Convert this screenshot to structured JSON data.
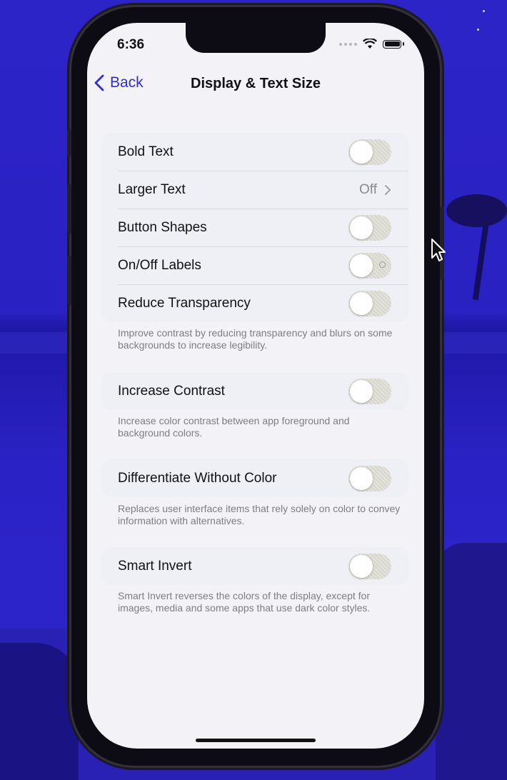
{
  "status_bar": {
    "time": "6:36"
  },
  "nav": {
    "back_label": "Back",
    "title": "Display & Text Size"
  },
  "groups": [
    {
      "rows": [
        {
          "label": "Bold Text",
          "type": "toggle",
          "on": false
        },
        {
          "label": "Larger Text",
          "type": "disclosure",
          "value": "Off"
        },
        {
          "label": "Button Shapes",
          "type": "toggle",
          "on": false
        },
        {
          "label": "On/Off Labels",
          "type": "toggle",
          "on": false
        },
        {
          "label": "Reduce Transparency",
          "type": "toggle",
          "on": false
        }
      ],
      "footnote": "Improve contrast by reducing transparency and blurs on some backgrounds to increase legibility."
    },
    {
      "rows": [
        {
          "label": "Increase Contrast",
          "type": "toggle",
          "on": false
        }
      ],
      "footnote": "Increase color contrast between app foreground and background colors."
    },
    {
      "rows": [
        {
          "label": "Differentiate Without Color",
          "type": "toggle",
          "on": false
        }
      ],
      "footnote": "Replaces user interface items that rely solely on color to convey information with alternatives."
    },
    {
      "rows": [
        {
          "label": "Smart Invert",
          "type": "toggle",
          "on": false
        }
      ],
      "footnote": "Smart Invert reverses the colors of the display, except for images, media and some apps that use dark color styles."
    }
  ],
  "colors": {
    "accent": "#2f2fd6",
    "screen_bg": "#f2f2f7",
    "desktop_bg": "#2d24c8"
  },
  "icons": [
    "chevron-left-icon",
    "chevron-right-icon",
    "wifi-icon",
    "battery-icon",
    "signal-icon",
    "mouse-pointer-icon"
  ]
}
